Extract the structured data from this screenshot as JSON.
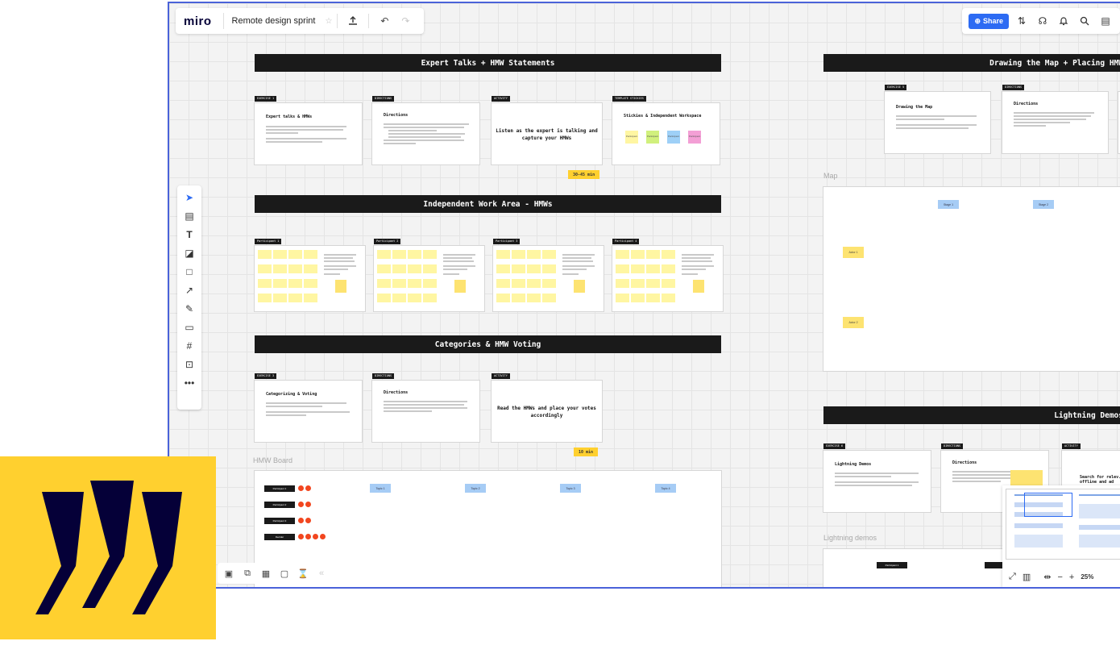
{
  "app": {
    "logo": "miro",
    "board_title": "Remote design sprint"
  },
  "toolbar_right": {
    "share_label": "Share"
  },
  "sections": [
    {
      "title": "Expert Talks + HMW Statements"
    },
    {
      "title": "Independent Work Area - HMWs"
    },
    {
      "title": "Categories & HMW Voting"
    },
    {
      "title": "Drawing the Map + Placing HMW"
    },
    {
      "title": "Lightning Demos"
    }
  ],
  "expert": {
    "tags": [
      "EXERCISE 1",
      "DIRECTIONS",
      "ACTIVITY",
      "TEMPLATE STICKIES"
    ],
    "frame1_title": "Expert talks & HMWs",
    "frame2_title": "Directions",
    "activity_text": "Listen as the expert is talking and capture your HMWs",
    "frame4_title": "Stickies & Independent Workspace",
    "timer": "30-45 min",
    "notes": [
      "Participant",
      "Participant",
      "Participant",
      "Participant"
    ]
  },
  "independent": {
    "tags": [
      "Participant 1",
      "Participant 2",
      "Participant 3",
      "Participant 4"
    ]
  },
  "categories": {
    "tags": [
      "EXERCISE 3",
      "DIRECTIONS",
      "ACTIVITY"
    ],
    "frame1_title": "Categorizing & Voting",
    "frame2_title": "Directions",
    "activity_text": "Read the HMWs and place your votes accordingly",
    "timer": "10 min"
  },
  "hmw_board": {
    "label": "HMW Board",
    "participants": [
      "Participant 1",
      "Participant 2",
      "Participant 3",
      "Decider"
    ],
    "topics": [
      "Topic 1",
      "Topic 2",
      "Topic 3",
      "Topic 4"
    ]
  },
  "map_section": {
    "tags": [
      "EXERCISE 5",
      "DIRECTIONS"
    ],
    "frame1_title": "Drawing the Map",
    "frame2_title": "Directions",
    "map_label": "Map",
    "stages": [
      "Stage 1",
      "Stage 2"
    ],
    "actors": [
      "Actor 1",
      "Actor 2"
    ]
  },
  "demos": {
    "tags": [
      "EXERCISE 6",
      "DIRECTIONS",
      "ACTIVITY"
    ],
    "frame1_title": "Lightning Demos",
    "frame2_title": "Directions",
    "activity_text": "Search for relev... offline and ad",
    "label": "Lightning demos",
    "participant": "Participant 1"
  },
  "zoom": "25%",
  "colors": {
    "brand_yellow": "#ffd02f",
    "brand_navy": "#050038",
    "accent_blue": "#2d6bf3",
    "vote_red": "#f2461f"
  }
}
